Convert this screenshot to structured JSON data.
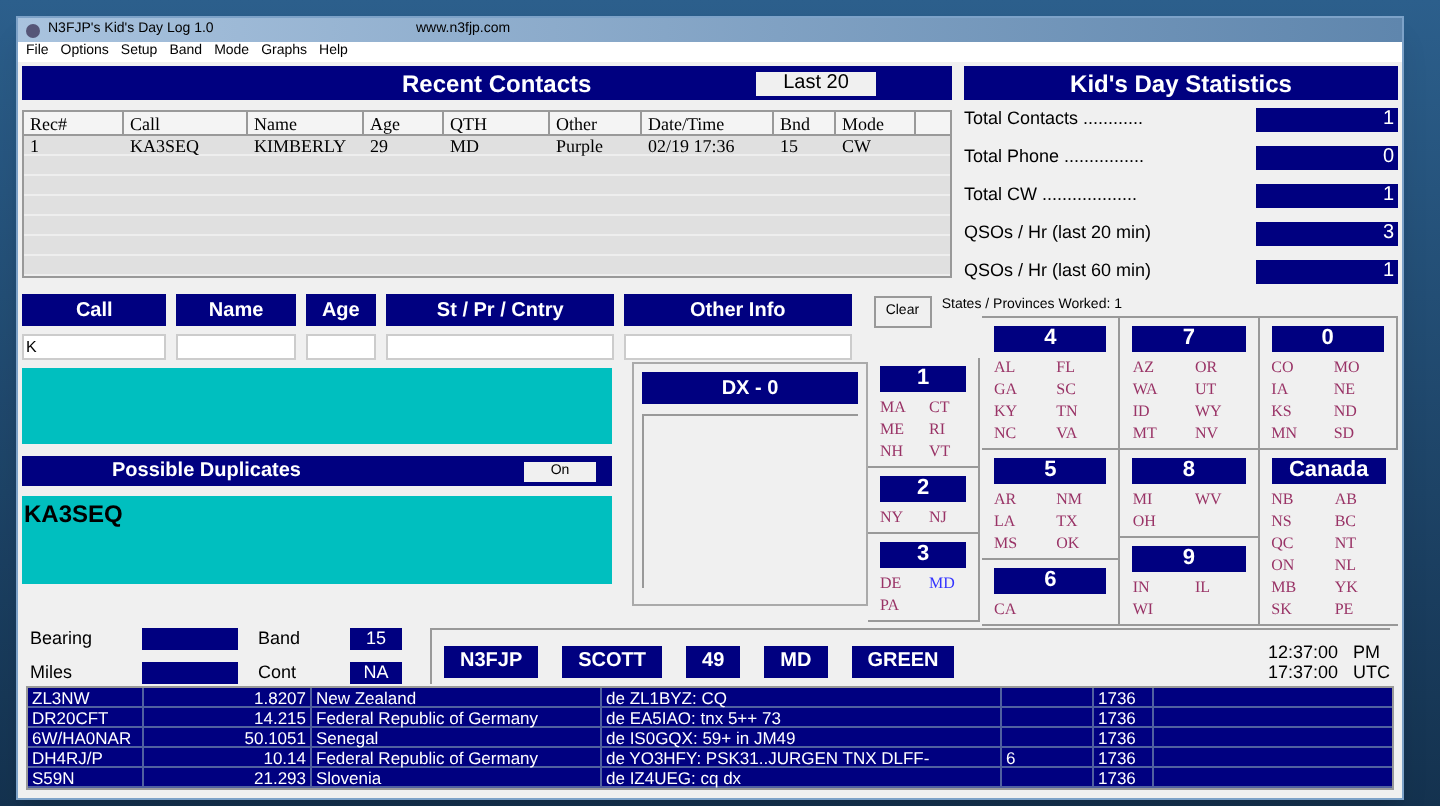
{
  "window": {
    "title": "N3FJP's Kid's Day Log 1.0",
    "url": "www.n3fjp.com"
  },
  "menu": [
    "File",
    "Options",
    "Setup",
    "Band",
    "Mode",
    "Graphs",
    "Help"
  ],
  "recent_contacts": {
    "title": "Recent Contacts",
    "button": "Last 20",
    "columns": [
      "Rec#",
      "Call",
      "Name",
      "Age",
      "QTH",
      "Other",
      "Date/Time",
      "Bnd",
      "Mode"
    ],
    "rows": [
      [
        "1",
        "KA3SEQ",
        "KIMBERLY",
        "29",
        "MD",
        "Purple",
        "02/19 17:36",
        "15",
        "CW"
      ]
    ]
  },
  "stats": {
    "title": "Kid's Day Statistics",
    "items": [
      {
        "label": "Total Contacts ............",
        "value": "1"
      },
      {
        "label": "Total Phone ................",
        "value": "0"
      },
      {
        "label": "Total CW ...................",
        "value": "1"
      },
      {
        "label": "QSOs / Hr (last 20 min)",
        "value": "3"
      },
      {
        "label": "QSOs / Hr (last 60 min)",
        "value": "1"
      }
    ]
  },
  "entry": {
    "fields": [
      {
        "label": "Call",
        "value": "K"
      },
      {
        "label": "Name"
      },
      {
        "label": "Age"
      },
      {
        "label": "St / Pr / Cntry"
      },
      {
        "label": "Other Info"
      }
    ],
    "clear_button": "Clear"
  },
  "duplicates": {
    "title": "Possible Duplicates",
    "toggle": "On",
    "calls": [
      "KA3SEQ"
    ]
  },
  "info": [
    {
      "label": "Bearing"
    },
    {
      "label": "Band",
      "value": "15"
    },
    {
      "label": "Miles"
    },
    {
      "label": "Cont",
      "value": "NA"
    }
  ],
  "dx": {
    "title": "DX  -  0"
  },
  "worked_summary": "States / Provinces Worked: 1",
  "regions": [
    {
      "title": "1",
      "states": [
        {
          "name": "MA",
          "worked": false
        },
        {
          "name": "CT",
          "worked": false
        },
        {
          "name": "ME",
          "worked": false
        },
        {
          "name": "RI",
          "worked": false
        },
        {
          "name": "NH",
          "worked": false
        },
        {
          "name": "VT",
          "worked": false
        }
      ]
    },
    {
      "title": "2",
      "states": [
        {
          "name": "NY",
          "worked": false
        },
        {
          "name": "NJ",
          "worked": false
        }
      ]
    },
    {
      "title": "3",
      "states": [
        {
          "name": "DE",
          "worked": false
        },
        {
          "name": "MD",
          "worked": true
        },
        {
          "name": "PA",
          "worked": false
        }
      ]
    },
    {
      "title": "4",
      "states": [
        {
          "name": "AL",
          "worked": false
        },
        {
          "name": "FL",
          "worked": false
        },
        {
          "name": "GA",
          "worked": false
        },
        {
          "name": "SC",
          "worked": false
        },
        {
          "name": "KY",
          "worked": false
        },
        {
          "name": "TN",
          "worked": false
        },
        {
          "name": "NC",
          "worked": false
        },
        {
          "name": "VA",
          "worked": false
        }
      ]
    },
    {
      "title": "5",
      "states": [
        {
          "name": "AR",
          "worked": false
        },
        {
          "name": "NM",
          "worked": false
        },
        {
          "name": "LA",
          "worked": false
        },
        {
          "name": "TX",
          "worked": false
        },
        {
          "name": "MS",
          "worked": false
        },
        {
          "name": "OK",
          "worked": false
        }
      ]
    },
    {
      "title": "6",
      "states": [
        {
          "name": "CA",
          "worked": false
        }
      ]
    },
    {
      "title": "7",
      "states": [
        {
          "name": "AZ",
          "worked": false
        },
        {
          "name": "OR",
          "worked": false
        },
        {
          "name": "WA",
          "worked": false
        },
        {
          "name": "UT",
          "worked": false
        },
        {
          "name": "ID",
          "worked": false
        },
        {
          "name": "WY",
          "worked": false
        },
        {
          "name": "MT",
          "worked": false
        },
        {
          "name": "NV",
          "worked": false
        }
      ]
    },
    {
      "title": "8",
      "states": [
        {
          "name": "MI",
          "worked": false
        },
        {
          "name": "WV",
          "worked": false
        },
        {
          "name": "OH",
          "worked": false
        }
      ]
    },
    {
      "title": "9",
      "states": [
        {
          "name": "IN",
          "worked": false
        },
        {
          "name": "IL",
          "worked": false
        },
        {
          "name": "WI",
          "worked": false
        }
      ]
    },
    {
      "title": "0",
      "states": [
        {
          "name": "CO",
          "worked": false
        },
        {
          "name": "MO",
          "worked": false
        },
        {
          "name": "IA",
          "worked": false
        },
        {
          "name": "NE",
          "worked": false
        },
        {
          "name": "KS",
          "worked": false
        },
        {
          "name": "ND",
          "worked": false
        },
        {
          "name": "MN",
          "worked": false
        },
        {
          "name": "SD",
          "worked": false
        }
      ]
    },
    {
      "title": "Canada",
      "states": [
        {
          "name": "NB",
          "worked": false
        },
        {
          "name": "AB",
          "worked": false
        },
        {
          "name": "NS",
          "worked": false
        },
        {
          "name": "BC",
          "worked": false
        },
        {
          "name": "QC",
          "worked": false
        },
        {
          "name": "NT",
          "worked": false
        },
        {
          "name": "ON",
          "worked": false
        },
        {
          "name": "NL",
          "worked": false
        },
        {
          "name": "MB",
          "worked": false
        },
        {
          "name": "YK",
          "worked": false
        },
        {
          "name": "SK",
          "worked": false
        },
        {
          "name": "PE",
          "worked": false
        }
      ]
    }
  ],
  "last_qso": [
    "N3FJP",
    "SCOTT",
    "49",
    "MD",
    "GREEN"
  ],
  "clock": {
    "local": "12:37:00",
    "local_suffix": "PM",
    "utc": "17:37:00",
    "utc_suffix": "UTC"
  },
  "cluster": [
    {
      "call": "ZL3NW",
      "freq": "1.8207",
      "country": "New Zealand",
      "comment": "de ZL1BYZ:  CQ",
      "time": "1736"
    },
    {
      "call": "DR20CFT",
      "freq": "14.215",
      "country": "Federal Republic of Germany",
      "comment": "de EA5IAO:  tnx  5++  73",
      "time": "1736"
    },
    {
      "call": "6W/HA0NAR",
      "freq": "50.1051",
      "country": "Senegal",
      "comment": "de IS0GQX:  59+ in JM49",
      "time": "1736"
    },
    {
      "call": "DH4RJ/P",
      "freq": "10.14",
      "country": "Federal Republic of Germany",
      "comment": "de YO3HFY:  PSK31..JURGEN TNX DLFF-",
      "column_5": "6",
      "time": "1736"
    },
    {
      "call": "S59N",
      "freq": "21.293",
      "country": "Slovenia",
      "comment": "de IZ4UEG:  cq dx",
      "time": "1736"
    }
  ]
}
